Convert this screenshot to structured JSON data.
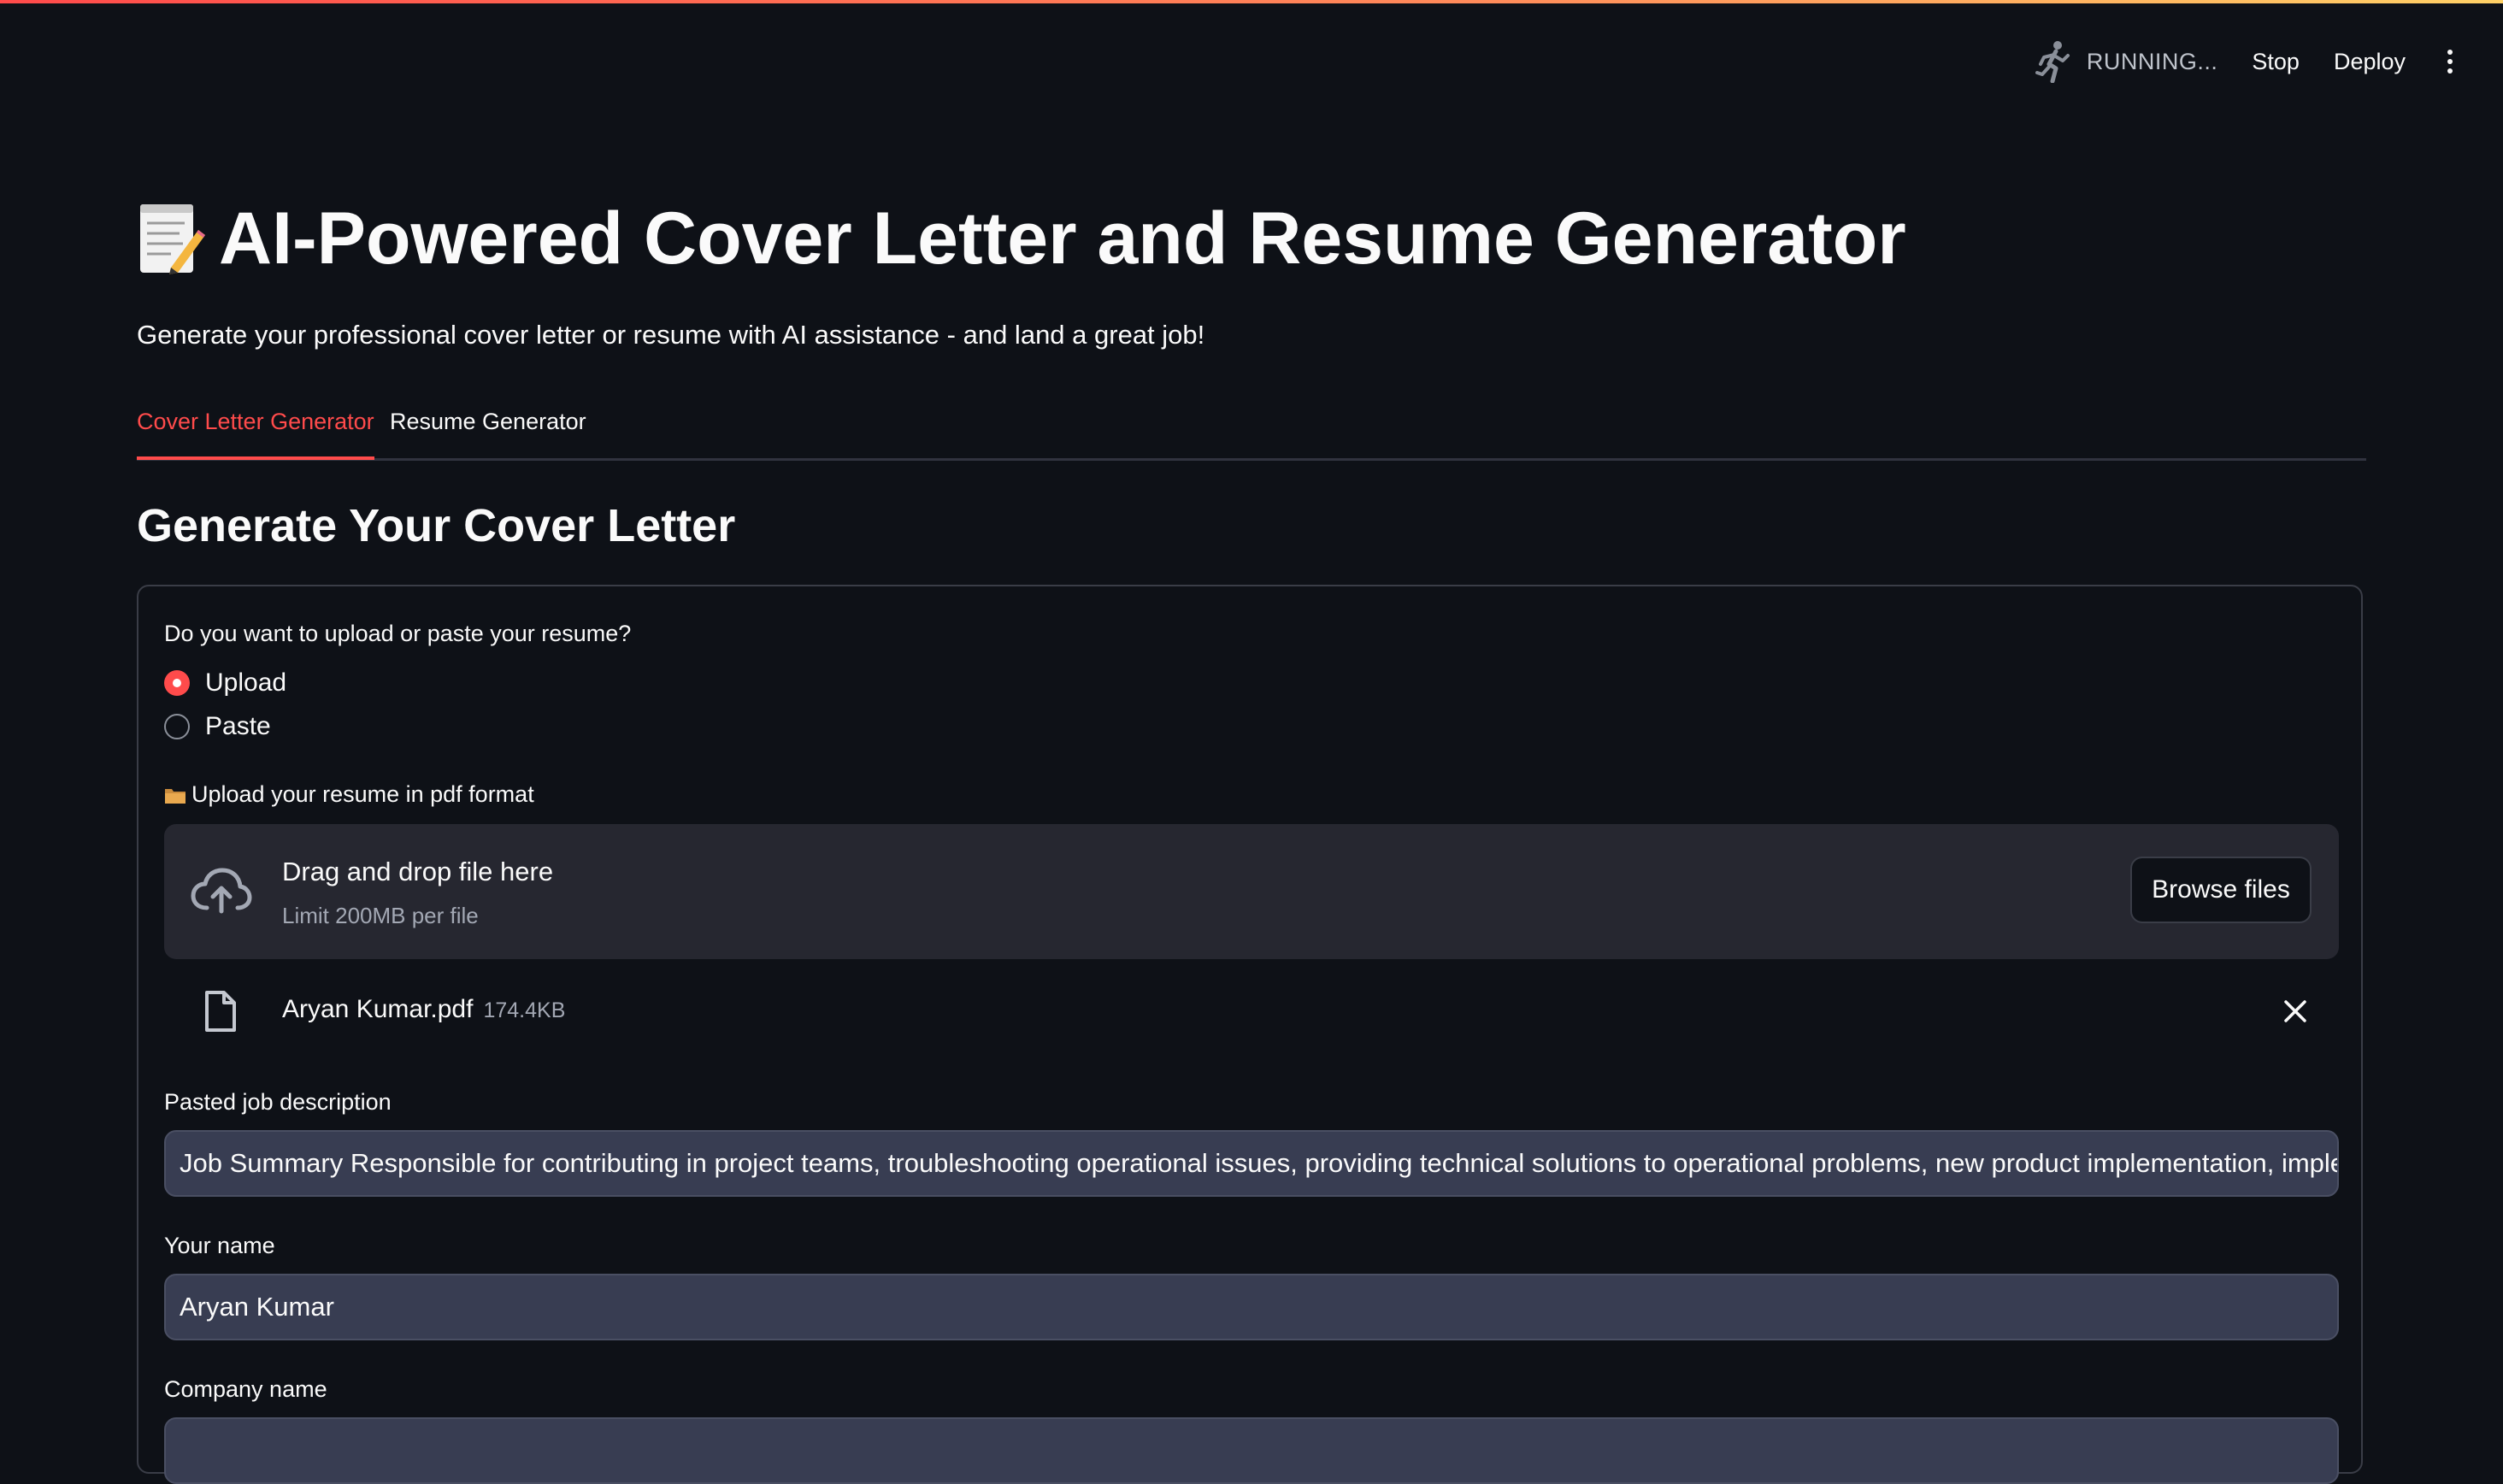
{
  "toolbar": {
    "status": "RUNNING...",
    "stop_label": "Stop",
    "deploy_label": "Deploy"
  },
  "header": {
    "title_emoji_icon": "memo-pencil-icon",
    "title": "AI-Powered Cover Letter and Resume Generator",
    "subtitle": "Generate your professional cover letter or resume with AI assistance - and land a great job!"
  },
  "tabs": [
    {
      "label": "Cover Letter Generator",
      "active": true
    },
    {
      "label": "Resume Generator",
      "active": false
    }
  ],
  "section": {
    "heading": "Generate Your Cover Letter"
  },
  "form": {
    "resume_source": {
      "question": "Do you want to upload or paste your resume?",
      "options": [
        "Upload",
        "Paste"
      ],
      "selected": "Upload"
    },
    "upload": {
      "label": "Upload your resume in pdf format",
      "dropzone_title": "Drag and drop file here",
      "dropzone_limit": "Limit 200MB per file",
      "browse_label": "Browse files",
      "file_name": "Aryan Kumar.pdf",
      "file_size": "174.4KB"
    },
    "job_description": {
      "label": "Pasted job description",
      "value": "Job Summary  Responsible for contributing in project teams, troubleshooting operational issues, providing technical solutions to operational problems, new product implementation, imple"
    },
    "your_name": {
      "label": "Your name",
      "value": "Aryan Kumar"
    },
    "company_name": {
      "label": "Company name"
    }
  },
  "colors": {
    "background": "#0e1117",
    "accent": "#ff4b4b",
    "input_bg": "#383d52",
    "dropzone_bg": "#262730"
  }
}
